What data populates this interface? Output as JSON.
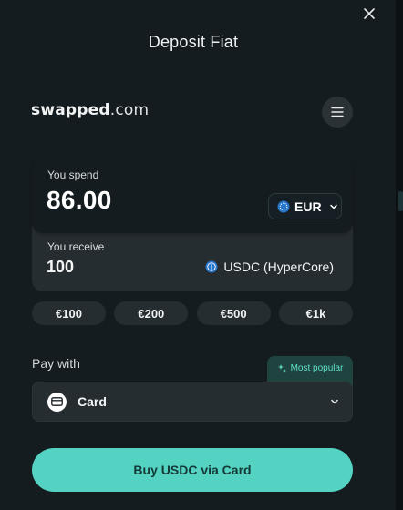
{
  "modal": {
    "title": "Deposit Fiat"
  },
  "brand": {
    "name_bold": "swapped",
    "name_suffix": ".com"
  },
  "spend": {
    "label": "You spend",
    "amount": "86.00",
    "currency": "EUR"
  },
  "receive": {
    "label": "You receive",
    "amount": "100",
    "token": "USDC (HyperCore)"
  },
  "presets": [
    "€100",
    "€200",
    "€500",
    "€1k"
  ],
  "payment": {
    "label": "Pay with",
    "badge": "Most popular",
    "method": "Card"
  },
  "cta": {
    "label": "Buy USDC via Card"
  },
  "colors": {
    "background": "#141c20",
    "surface": "#262d31",
    "accent": "#55d3c2",
    "badge_bg": "#1f433f",
    "badge_text": "#5fe0c8",
    "currency_blue": "#2775ca"
  },
  "icons": {
    "close": "close-icon",
    "menu": "hamburger-menu-icon",
    "currency": "euro-coin-icon",
    "token": "usdc-coin-icon",
    "sparkle": "sparkle-icon",
    "card": "credit-card-icon",
    "chevron": "chevron-down-icon"
  }
}
